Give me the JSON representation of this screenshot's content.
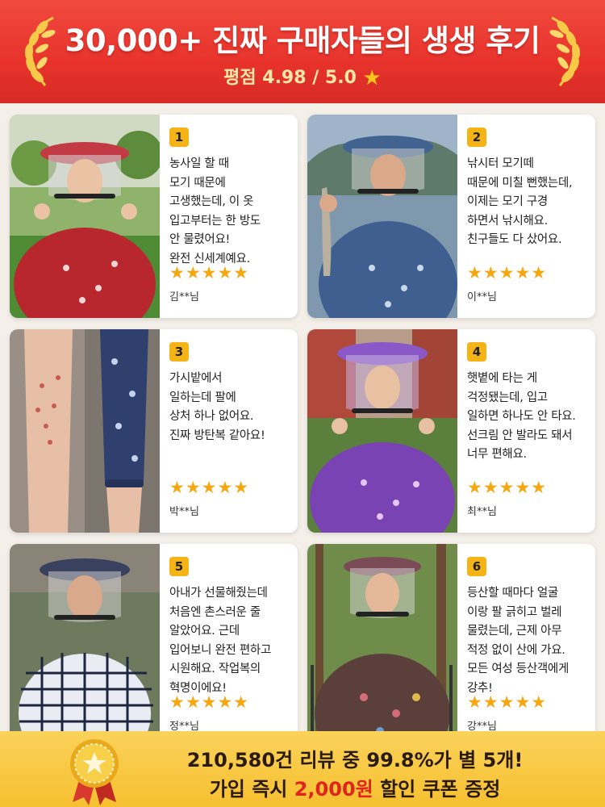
{
  "header": {
    "title": "30,000+ 진짜 구매자들의 생생 후기",
    "rating_prefix": "평점 4.98 / 5.0",
    "rating_star": "★"
  },
  "reviews": [
    {
      "number": "1",
      "text": "농사일 할 때\n모기 때문에\n고생했는데, 이 옷\n입고부터는 한 방도\n안 물렸어요!\n완전 신세계예요.",
      "stars": "★★★★★",
      "reviewer": "김**님"
    },
    {
      "number": "2",
      "text": "낚시터 모기떼\n때문에 미칠 뻔했는데,\n이제는 모기 구경\n하면서 낚시해요.\n친구들도 다 샀어요.",
      "stars": "★★★★★",
      "reviewer": "이**님"
    },
    {
      "number": "3",
      "text": "가시밭에서\n일하는데 팔에\n상처 하나 없어요.\n진짜 방탄복 같아요!",
      "stars": "★★★★★",
      "reviewer": "박**님"
    },
    {
      "number": "4",
      "text": "햇볕에 타는 게\n걱정됐는데, 입고\n일하면 하나도 안 타요.\n선크림 안 발라도 돼서\n너무 편해요.",
      "stars": "★★★★★",
      "reviewer": "최**님"
    },
    {
      "number": "5",
      "text": "아내가 선물해줬는데\n처음엔 촌스러운 줄\n알았어요. 근데\n입어보니 완전 편하고\n시원해요. 작업복의\n혁명이에요!",
      "stars": "★★★★★",
      "reviewer": "정**님"
    },
    {
      "number": "6",
      "text": "등산할 때마다 얼굴\n이랑 팔 긁히고 벌레\n물렸는데, 근제 아무\n적정 없이 산에 가요.\n모든 여성 등산객에게\n강추!",
      "stars": "★★★★★",
      "reviewer": "강**님"
    }
  ],
  "footer": {
    "line1": "210,580건 리뷰 중 99.8%가 별 5개!",
    "line2_before": "가입 즉시 ",
    "line2_highlight": "2,000원",
    "line2_after": " 할인 쿠폰 증정"
  },
  "colors": {
    "header_red": "#e8332c",
    "badge_yellow": "#f5b416",
    "star_gold": "#f5a712",
    "footer_yellow": "#f6c030",
    "coupon_red": "#e0241d"
  },
  "icons": {
    "laurel": "laurel-wreath-icon",
    "star": "star-icon",
    "medal": "medal-icon"
  }
}
